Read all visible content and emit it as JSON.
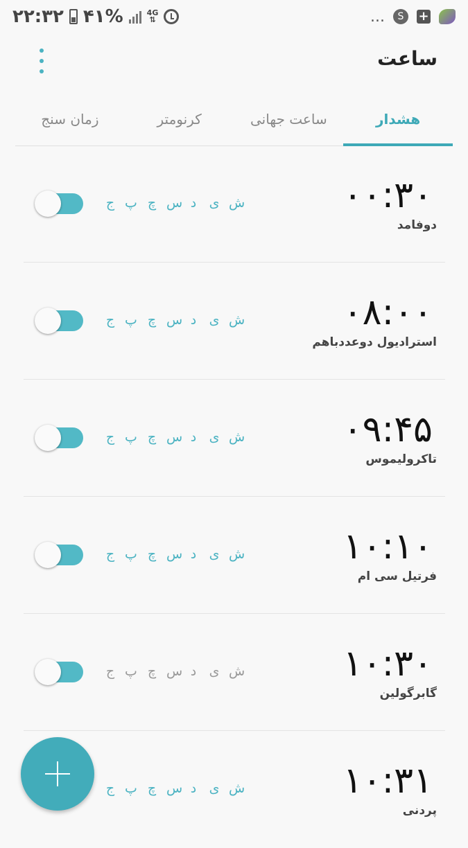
{
  "status_bar": {
    "time": "۲۲:۳۲",
    "battery": "۴۱%",
    "network": "4G",
    "overflow": "..."
  },
  "header": {
    "title": "ساعت"
  },
  "tabs": [
    {
      "label": "هشدار",
      "active": true
    },
    {
      "label": "ساعت جهانی",
      "active": false
    },
    {
      "label": "کرنومتر",
      "active": false
    },
    {
      "label": "زمان سنج",
      "active": false
    }
  ],
  "days": [
    "ش",
    "ی",
    "د",
    "س",
    "چ",
    "پ",
    "ج"
  ],
  "alarms": [
    {
      "time": "۰۰:۳۰",
      "label": "دوفامد",
      "enabled": true,
      "days_dim": false
    },
    {
      "time": "۰۸:۰۰",
      "label": "استرادیول دوعددباهم",
      "enabled": true,
      "days_dim": false
    },
    {
      "time": "۰۹:۴۵",
      "label": "تاکرولیموس",
      "enabled": true,
      "days_dim": false
    },
    {
      "time": "۱۰:۱۰",
      "label": "فرتیل سی ام",
      "enabled": true,
      "days_dim": false
    },
    {
      "time": "۱۰:۳۰",
      "label": "گابرگولین",
      "enabled": true,
      "days_dim": true
    },
    {
      "time": "۱۰:۳۱",
      "label": "پردنی",
      "enabled": true,
      "days_dim": false
    }
  ],
  "colors": {
    "accent": "#3ea9b7",
    "toggle_track": "#52b9c6",
    "fab": "#42acba"
  }
}
